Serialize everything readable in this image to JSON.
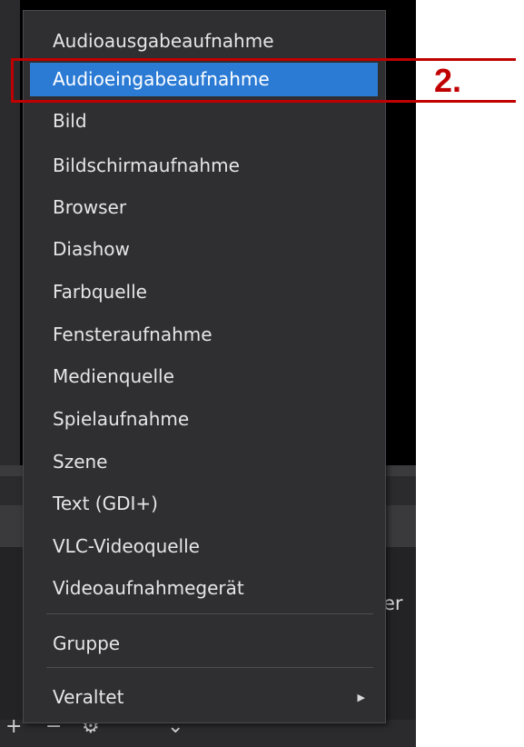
{
  "menu": {
    "items": [
      {
        "label": "Audioausgabeaufnahme"
      },
      {
        "label": "Audioeingabeaufnahme",
        "highlighted": true
      },
      {
        "label": "Bild"
      },
      {
        "label": "Bildschirmaufnahme"
      },
      {
        "label": "Browser"
      },
      {
        "label": "Diashow"
      },
      {
        "label": "Farbquelle"
      },
      {
        "label": "Fensteraufnahme"
      },
      {
        "label": "Medienquelle"
      },
      {
        "label": "Spielaufnahme"
      },
      {
        "label": "Szene"
      },
      {
        "label": "Text (GDI+)"
      },
      {
        "label": "VLC-Videoquelle"
      },
      {
        "label": "Videoaufnahmegerät"
      }
    ],
    "group_label": "Gruppe",
    "deprecated_label": "Veraltet",
    "submenu_arrow_icon": "chevron-right-icon"
  },
  "annotation": {
    "step_label": "2.",
    "color": "#c00000"
  },
  "background": {
    "dock_text": "er",
    "toolbar_icons": [
      "plus-icon",
      "minus-icon",
      "gear-icon",
      "chevron-up-icon",
      "chevron-down-icon"
    ]
  },
  "colors": {
    "highlight": "#2b7bd5",
    "menu_background": "#2f2f32"
  }
}
